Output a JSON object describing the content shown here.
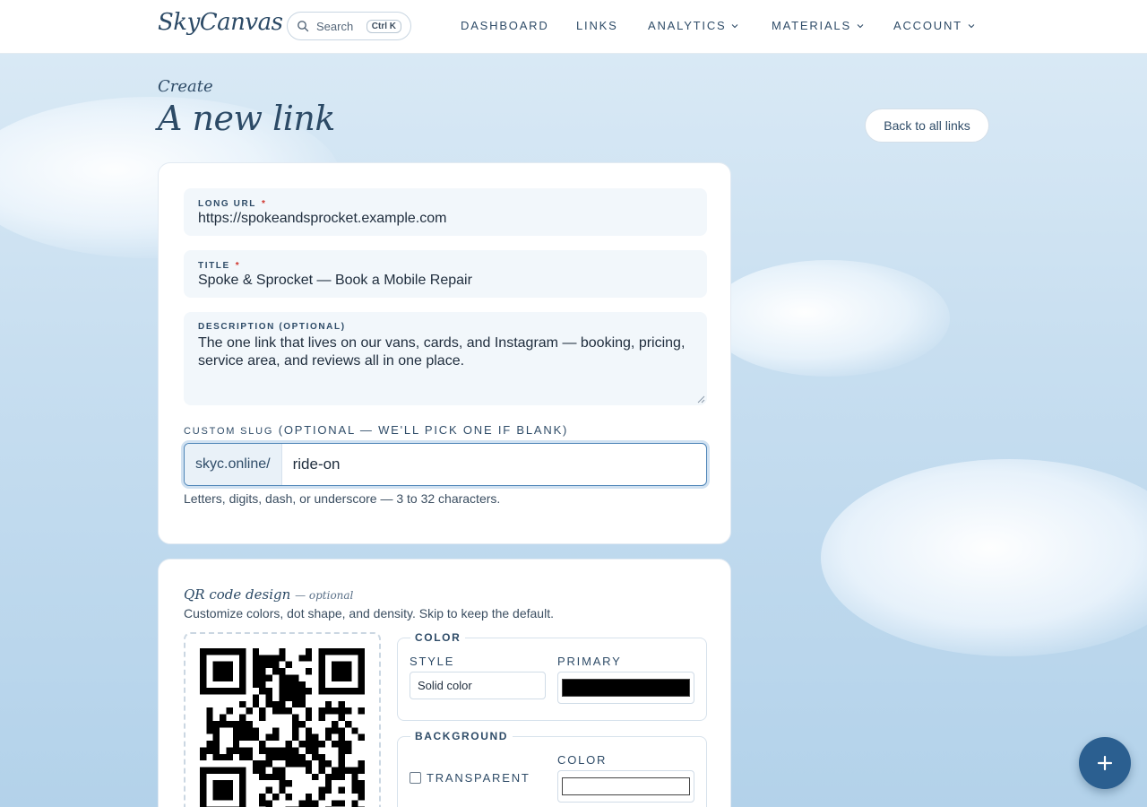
{
  "header": {
    "logo": "SkyCanvas",
    "search": {
      "label": "Search",
      "shortcut": "Ctrl K"
    },
    "nav": [
      {
        "label": "DASHBOARD",
        "has_menu": false
      },
      {
        "label": "LINKS",
        "has_menu": false
      },
      {
        "label": "ANALYTICS",
        "has_menu": true
      },
      {
        "label": "MATERIALS",
        "has_menu": true
      },
      {
        "label": "ACCOUNT",
        "has_menu": true
      }
    ]
  },
  "page": {
    "eyebrow": "Create",
    "title": "A new link",
    "back_button": "Back to all links"
  },
  "form": {
    "long_url": {
      "label": "LONG URL",
      "required_mark": "*",
      "value": "https://spokeandsprocket.example.com"
    },
    "title": {
      "label": "TITLE",
      "required_mark": "*",
      "value": "Spoke & Sprocket — Book a Mobile Repair"
    },
    "description": {
      "label": "DESCRIPTION (OPTIONAL)",
      "value": "The one link that lives on our vans, cards, and Instagram — booking, pricing, service area, and reviews all in one place."
    },
    "slug": {
      "label": "CUSTOM SLUG",
      "label_note": "(OPTIONAL — WE'LL PICK ONE IF BLANK)",
      "prefix": "skyc.online/",
      "value": "ride-on",
      "help": "Letters, digits, dash, or underscore — 3 to 32 characters."
    }
  },
  "qr": {
    "heading": "QR code design",
    "heading_note": "— optional",
    "subtitle": "Customize colors, dot shape, and density. Skip to keep the default.",
    "color": {
      "legend": "COLOR",
      "style_label": "STYLE",
      "style_value": "Solid color",
      "primary_label": "PRIMARY",
      "primary_hex": "#000000"
    },
    "background": {
      "legend": "BACKGROUND",
      "transparent_label": "TRANSPARENT",
      "transparent_checked": false,
      "color_label": "COLOR",
      "color_hex": "#ffffff"
    }
  },
  "theme": {
    "accent": "#2b5f90",
    "required": "#d0342c"
  }
}
